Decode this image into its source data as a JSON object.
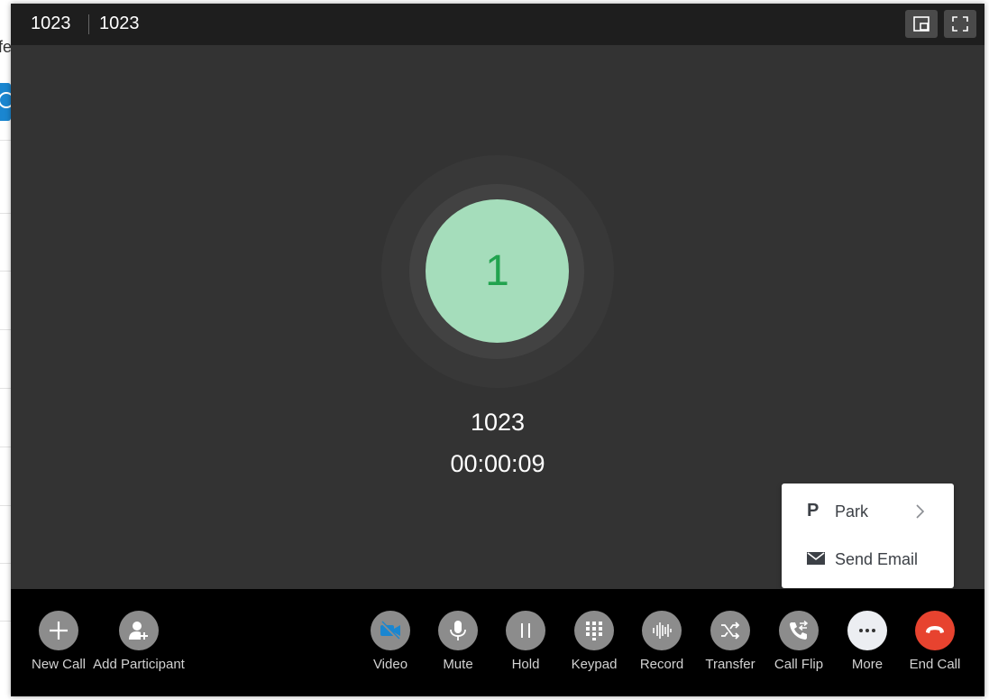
{
  "background_app": {
    "partial_text": "fe"
  },
  "title_bar": {
    "extension": "1023",
    "display_name": "1023"
  },
  "caller": {
    "avatar_initial": "1",
    "name": "1023",
    "duration": "00:00:09"
  },
  "more_menu": {
    "items": [
      {
        "label": "Park",
        "icon": "park-icon",
        "has_submenu": true
      },
      {
        "label": "Send Email",
        "icon": "mail-icon",
        "has_submenu": false
      }
    ]
  },
  "toolbar": {
    "left": [
      {
        "label": "New Call",
        "icon": "plus-icon"
      },
      {
        "label": "Add Participant",
        "icon": "add-person-icon"
      }
    ],
    "right": [
      {
        "label": "Video",
        "icon": "video-off-icon"
      },
      {
        "label": "Mute",
        "icon": "microphone-icon"
      },
      {
        "label": "Hold",
        "icon": "pause-icon"
      },
      {
        "label": "Keypad",
        "icon": "keypad-icon"
      },
      {
        "label": "Record",
        "icon": "waveform-icon"
      },
      {
        "label": "Transfer",
        "icon": "shuffle-icon"
      },
      {
        "label": "Call Flip",
        "icon": "phone-swap-icon"
      },
      {
        "label": "More",
        "icon": "ellipsis-icon"
      },
      {
        "label": "End Call",
        "icon": "hangup-icon"
      }
    ]
  },
  "colors": {
    "window_bg": "#333333",
    "titlebar_bg": "#1e1e1e",
    "toolbar_bg": "#000000",
    "avatar_bg": "#a5ddbb",
    "avatar_text": "#22a34f",
    "end_call": "#e7432f",
    "video_icon": "#1a86d0",
    "button_grey": "#8c8c8c"
  }
}
